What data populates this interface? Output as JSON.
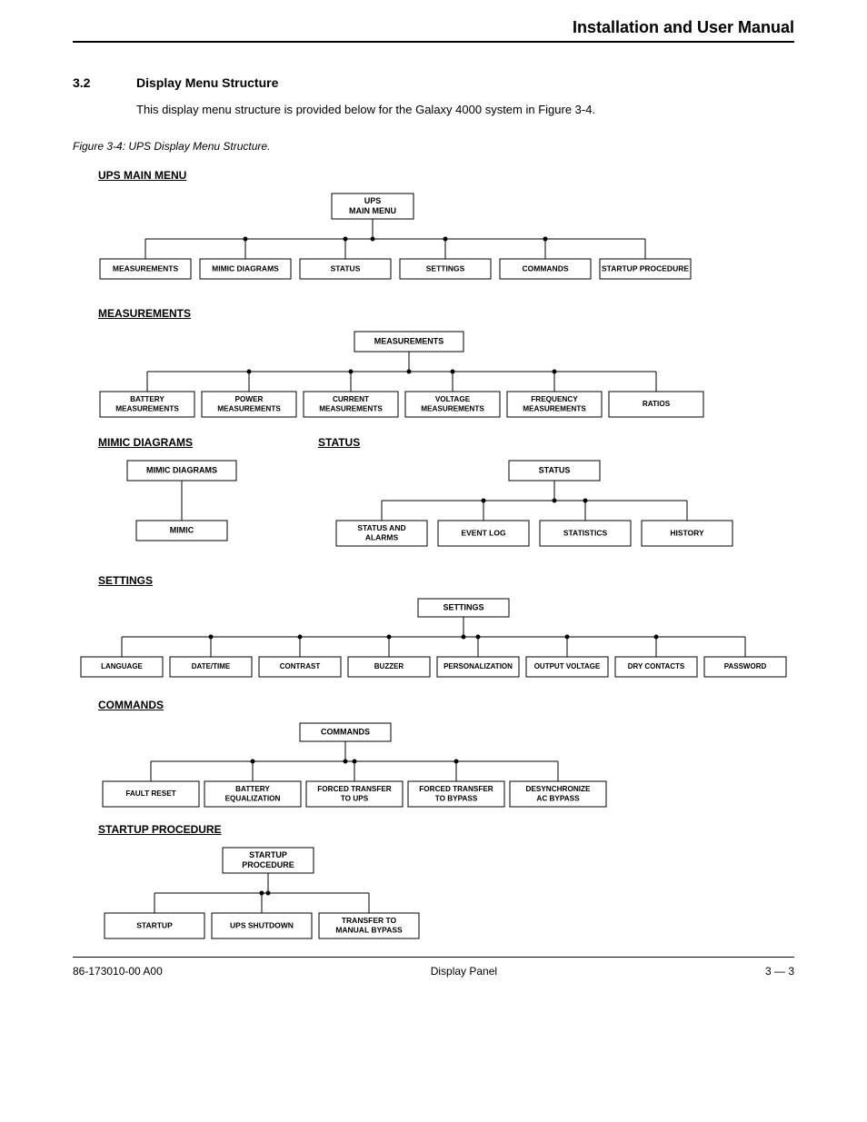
{
  "header": {
    "title": "Installation and User Manual"
  },
  "section": {
    "number": "3.2",
    "title": "Display Menu Structure",
    "body": "This display menu structure is provided below for the Galaxy 4000 system in Figure 3-4."
  },
  "figure_caption": "Figure 3-4:  UPS Display Menu Structure.",
  "trees": {
    "main": {
      "heading": "UPS MAIN MENU",
      "root": "UPS\nMAIN MENU",
      "children": [
        "MEASUREMENTS",
        "MIMIC DIAGRAMS",
        "STATUS",
        "SETTINGS",
        "COMMANDS",
        "STARTUP PROCEDURE"
      ]
    },
    "measurements": {
      "heading": "MEASUREMENTS",
      "root": "MEASUREMENTS",
      "children": [
        "BATTERY\nMEASUREMENTS",
        "POWER\nMEASUREMENTS",
        "CURRENT\nMEASUREMENTS",
        "VOLTAGE\nMEASUREMENTS",
        "FREQUENCY\nMEASUREMENTS",
        "RATIOS"
      ]
    },
    "mimic": {
      "heading": "MIMIC DIAGRAMS",
      "root": "MIMIC DIAGRAMS",
      "children": [
        "MIMIC"
      ]
    },
    "status": {
      "heading": "STATUS",
      "root": "STATUS",
      "children": [
        "STATUS AND\nALARMS",
        "EVENT LOG",
        "STATISTICS",
        "HISTORY"
      ]
    },
    "settings": {
      "heading": "SETTINGS",
      "root": "SETTINGS",
      "children": [
        "LANGUAGE",
        "DATE/TIME",
        "CONTRAST",
        "BUZZER",
        "PERSONALIZATION",
        "OUTPUT VOLTAGE",
        "DRY CONTACTS",
        "PASSWORD"
      ]
    },
    "commands": {
      "heading": "COMMANDS",
      "root": "COMMANDS",
      "children": [
        "FAULT RESET",
        "BATTERY\nEQUALIZATION",
        "FORCED TRANSFER\nTO UPS",
        "FORCED TRANSFER\nTO BYPASS",
        "DESYNCHRONIZE\nAC BYPASS"
      ]
    },
    "startup": {
      "heading": "STARTUP PROCEDURE",
      "root": "STARTUP\nPROCEDURE",
      "children": [
        "STARTUP",
        "UPS SHUTDOWN",
        "TRANSFER TO\nMANUAL BYPASS"
      ]
    }
  },
  "footer": {
    "left": "86-173010-00 A00",
    "center": "Display Panel",
    "right": "3 — 3"
  }
}
